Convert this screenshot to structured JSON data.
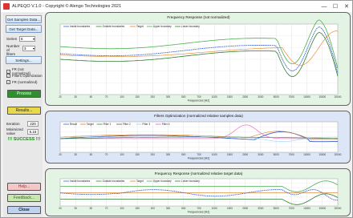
{
  "window": {
    "title": "ALPEQO V.1.0 - Copyright © Alengo Technologies 2021",
    "min": "—",
    "max": "☐",
    "close": "✕"
  },
  "sidebar": {
    "get_samples": "Get Samples Data...",
    "get_target": "Get Target Data...",
    "series_label": "Series",
    "series_value": "6",
    "filters_label": "Number of filters",
    "filters_value": "3",
    "settings": "Settings...",
    "chk_fr": "FR (not normalized)",
    "chk_fo": "Filters Optimization",
    "chk_frn": "FR (normalized)",
    "process": "Process",
    "results": "Results...",
    "iteration_label": "Iteration",
    "iteration_value": "220",
    "minimized_label": "Minimized value",
    "minimized_value": "5.16",
    "success": "!!! SUCCESS !!!",
    "help": "Help...",
    "feedback": "Feedback...",
    "close": "Close"
  },
  "colors": {
    "panel1_bg": "#e4f4e4",
    "panel2_bg": "#dde6f6",
    "panel3_bg": "#e4f4e4",
    "green_btn": "#2f8f2f",
    "yellow_btn": "#e8d84a",
    "pink_btn": "#f4c8c8",
    "lightgreen_btn": "#c8e8b0",
    "blue_btn": "#bcd2f0"
  },
  "charts": {
    "fr": {
      "title": "Frequency Response (not normalized)",
      "xlabel": "Frequencies [Hz]",
      "ticks": [
        "20",
        "30",
        "50",
        "70",
        "100",
        "150",
        "200",
        "300",
        "500",
        "700",
        "1000",
        "1500",
        "2000",
        "3000",
        "5000",
        "7000",
        "10000",
        "15000",
        "20000"
      ],
      "legend": [
        "Inside boundaries",
        "Outside boundaries",
        "Target",
        "Upper boundary",
        "Lower boundary"
      ]
    },
    "fo": {
      "title": "Filters Optimization (normalized relative samples data)",
      "xlabel": "Frequencies [Hz]",
      "ticks": [
        "20",
        "30",
        "50",
        "70",
        "100",
        "150",
        "200",
        "300",
        "500",
        "700",
        "1000",
        "1500",
        "2000",
        "3000",
        "5000",
        "7000",
        "10000",
        "15000",
        "20000"
      ],
      "legend": [
        "Result",
        "Target",
        "Filter 1",
        "Filter 2",
        "Filter 3",
        "Filter 4"
      ]
    },
    "frn": {
      "title": "Frequency Response (normalized relative target data)",
      "xlabel": "Frequencies [Hz]",
      "ticks": [
        "20",
        "30",
        "50",
        "70",
        "100",
        "150",
        "200",
        "300",
        "500",
        "700",
        "1000",
        "1500",
        "2000",
        "3000",
        "5000",
        "7000",
        "10000",
        "15000",
        "20000"
      ],
      "legend": [
        "Inside boundaries",
        "Outside boundaries",
        "Target",
        "Upper boundary",
        "Lower boundary"
      ]
    }
  }
}
